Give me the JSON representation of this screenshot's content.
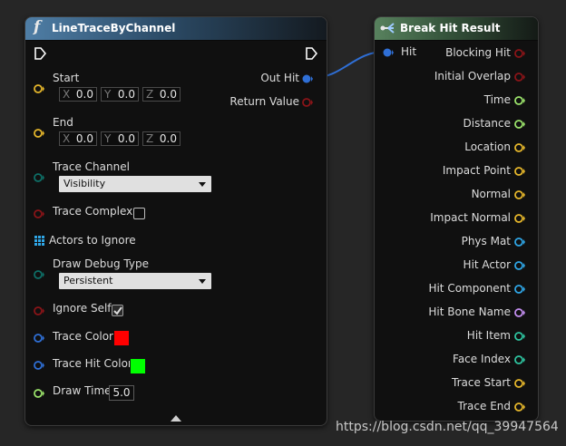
{
  "colors": {
    "bool_pin": "#8a1418",
    "float_pin": "#9be36b",
    "vector_pin": "#e6b72b",
    "struct_pin": "#2f6fd6",
    "name_pin": "#c38ef0",
    "object_pin": "#2fa6e6",
    "enum_pin": "#0e6f67",
    "int_pin": "#2ec4a0",
    "trace_color": "#ff0000",
    "trace_hit_color": "#00ff00"
  },
  "node1": {
    "title": "LineTraceByChannel",
    "icon": "function-icon",
    "start": {
      "label": "Start",
      "x": "0.0",
      "y": "0.0",
      "z": "0.0"
    },
    "end": {
      "label": "End",
      "x": "0.0",
      "y": "0.0",
      "z": "0.0"
    },
    "axis": {
      "x": "X",
      "y": "Y",
      "z": "Z"
    },
    "trace_channel": {
      "label": "Trace Channel",
      "value": "Visibility"
    },
    "trace_complex": {
      "label": "Trace Complex",
      "checked": false
    },
    "actors_to_ignore": {
      "label": "Actors to Ignore"
    },
    "draw_debug_type": {
      "label": "Draw Debug Type",
      "value": "Persistent"
    },
    "ignore_self": {
      "label": "Ignore Self",
      "checked": true
    },
    "trace_color": {
      "label": "Trace Color"
    },
    "trace_hit_color": {
      "label": "Trace Hit Color"
    },
    "draw_time": {
      "label": "Draw Time",
      "value": "5.0"
    },
    "out_hit": {
      "label": "Out Hit"
    },
    "return_value": {
      "label": "Return Value"
    }
  },
  "node2": {
    "title": "Break Hit Result",
    "input": {
      "label": "Hit"
    },
    "outputs": [
      {
        "label": "Blocking Hit",
        "type": "bool"
      },
      {
        "label": "Initial Overlap",
        "type": "bool"
      },
      {
        "label": "Time",
        "type": "float"
      },
      {
        "label": "Distance",
        "type": "float"
      },
      {
        "label": "Location",
        "type": "vector"
      },
      {
        "label": "Impact Point",
        "type": "vector"
      },
      {
        "label": "Normal",
        "type": "vector"
      },
      {
        "label": "Impact Normal",
        "type": "vector"
      },
      {
        "label": "Phys Mat",
        "type": "object"
      },
      {
        "label": "Hit Actor",
        "type": "object"
      },
      {
        "label": "Hit Component",
        "type": "object"
      },
      {
        "label": "Hit Bone Name",
        "type": "name"
      },
      {
        "label": "Hit Item",
        "type": "int"
      },
      {
        "label": "Face Index",
        "type": "int"
      },
      {
        "label": "Trace Start",
        "type": "vector"
      },
      {
        "label": "Trace End",
        "type": "vector"
      }
    ]
  },
  "watermark": "https://blog.csdn.net/qq_39947564"
}
